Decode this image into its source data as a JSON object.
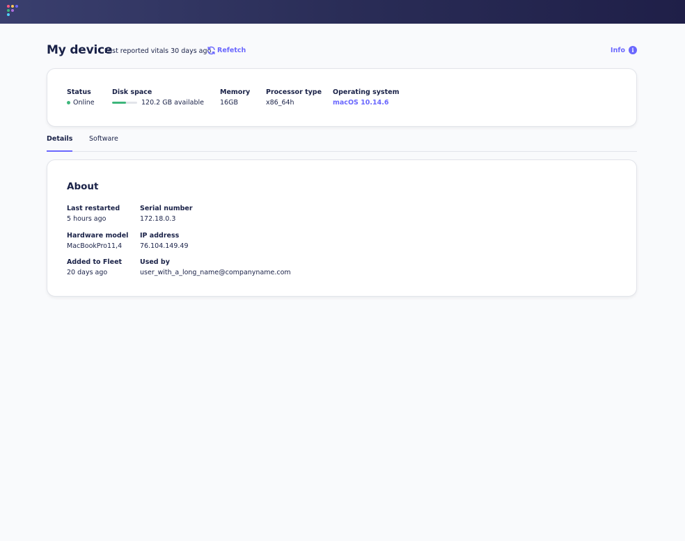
{
  "brand": {
    "logo_dot_colors": [
      "#ff5c83",
      "#ffc75a",
      "#6a67fe",
      "#3db67b",
      "#ae6ddf",
      "#4fd0ff"
    ]
  },
  "header": {
    "title": "My device",
    "last_reported": "Last reported vitals 30 days ago",
    "refetch_label": "Refetch",
    "info_label": "Info",
    "info_icon_glyph": "i"
  },
  "vitals": {
    "status": {
      "label": "Status",
      "value": "Online"
    },
    "disk": {
      "label": "Disk space",
      "value": "120.2 GB available",
      "used_fraction": 0.55
    },
    "memory": {
      "label": "Memory",
      "value": "16GB"
    },
    "processor": {
      "label": "Processor type",
      "value": "x86_64h"
    },
    "os": {
      "label": "Operating system",
      "value": "macOS 10.14.6"
    }
  },
  "tabs": [
    {
      "label": "Details",
      "active": true
    },
    {
      "label": "Software",
      "active": false
    }
  ],
  "about": {
    "title": "About",
    "last_restarted": {
      "label": "Last restarted",
      "value": "5 hours ago"
    },
    "hardware_model": {
      "label": "Hardware model",
      "value": "MacBookPro11,4"
    },
    "added_to_fleet": {
      "label": "Added to Fleet",
      "value": "20 days ago"
    },
    "serial_number": {
      "label": "Serial number",
      "value": "172.18.0.3"
    },
    "ip_address": {
      "label": "IP address",
      "value": "76.104.149.49"
    },
    "used_by": {
      "label": "Used by",
      "value": "user_with_a_long_name@companyname.com"
    }
  },
  "colors": {
    "accent": "#6a67fe",
    "online": "#3db67b",
    "text": "#192147"
  }
}
